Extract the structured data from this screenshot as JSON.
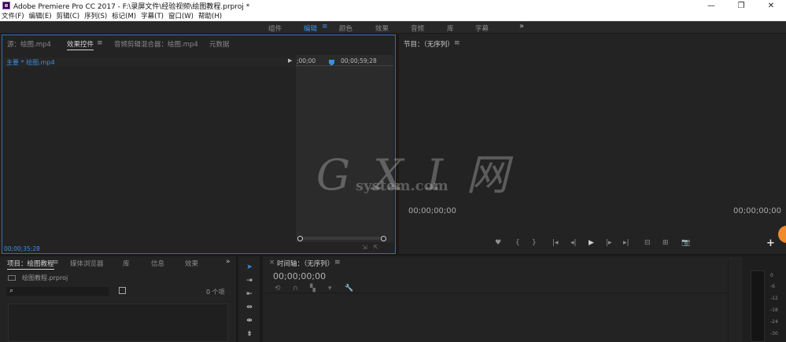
{
  "window": {
    "title": "Adobe Premiere Pro CC 2017 - F:\\录屏文件\\经验视频\\绘图教程.prproj *",
    "controls": [
      "—",
      "❐",
      "✕"
    ]
  },
  "menu": [
    "文件(F)",
    "编辑(E)",
    "剪辑(C)",
    "序列(S)",
    "标记(M)",
    "字幕(T)",
    "窗口(W)",
    "帮助(H)"
  ],
  "workspaces": {
    "items": [
      "组件",
      "编辑",
      "颜色",
      "效果",
      "音频",
      "库",
      "字幕"
    ],
    "active": "编辑",
    "menu_icon": "≡",
    "more": "»"
  },
  "source_panel": {
    "tabs": [
      "源：绘图.mp4",
      "效果控件",
      "音频剪辑混合器：绘图.mp4",
      "元数据"
    ],
    "active_tab": "效果控件",
    "menu_icon": "≡",
    "master_clip": "主要 * 绘图.mp4",
    "time_start": ";00;00",
    "time_end": "00;00;59;28",
    "current_time": "00;00;35;28"
  },
  "program_monitor": {
    "title": "节目：（无序列）",
    "menu_icon": "≡",
    "time_left": "00;00;00;00",
    "time_right": "00;00;00;00",
    "controls": [
      "♥",
      "{",
      "}",
      "|◂",
      "◂|",
      "▶",
      "|▸",
      "▸|",
      "⊟",
      "⊞",
      "📷"
    ],
    "add": "+"
  },
  "watermark": {
    "big": "G X I 网",
    "small": "system.com"
  },
  "project_panel": {
    "tabs": [
      "项目：绘图教程",
      "媒体浏览器",
      "库",
      "信息",
      "效果"
    ],
    "active_tab": "项目：绘图教程",
    "menu_icon": "≡",
    "more": "»",
    "project_file": "绘图教程.prproj",
    "search_placeholder": "",
    "count": "0 个项"
  },
  "tools": [
    "selection-tool",
    "track-select-tool",
    "ripple-edit-tool",
    "rolling-edit-tool",
    "rate-stretch-tool",
    "razor-tool"
  ],
  "timeline": {
    "title": "时间轴：（无序列）",
    "menu_icon": "≡",
    "close": "×",
    "time": "00;00;00;00"
  },
  "audio_meter": {
    "ticks": [
      "0",
      "-6",
      "-12",
      "-18",
      "-24",
      "-30"
    ]
  },
  "colors": {
    "accent": "#3d90e0",
    "panel_bg": "#232323",
    "active_border": "#2e6fb5"
  }
}
